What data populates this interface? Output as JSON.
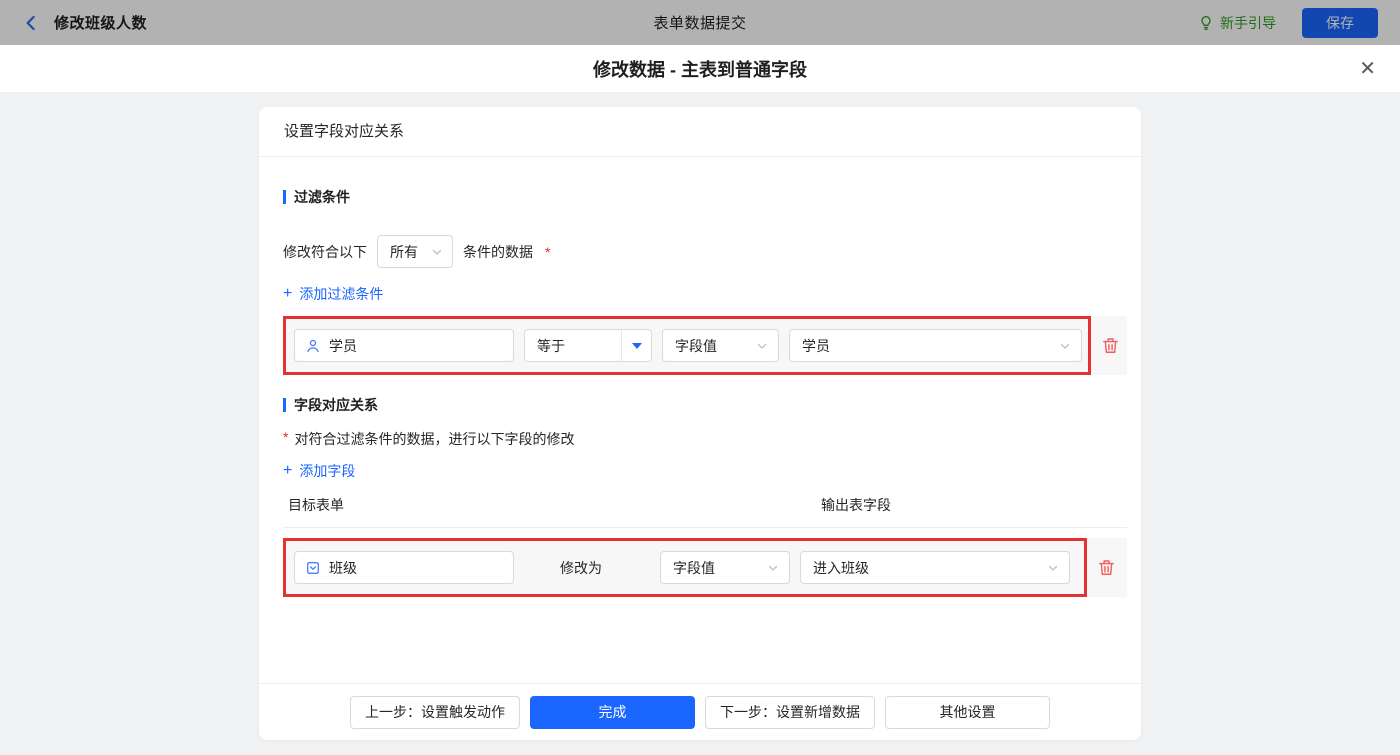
{
  "topbar": {
    "back_title": "修改班级人数",
    "center_title": "表单数据提交",
    "guide_label": "新手引导",
    "save_label": "保存"
  },
  "dialog": {
    "title": "修改数据 - 主表到普通字段",
    "close_glyph": "✕"
  },
  "card": {
    "header_title": "设置字段对应关系",
    "filter": {
      "title": "过滤条件",
      "match_prefix": "修改符合以下",
      "match_value": "所有",
      "match_suffix": "条件的数据",
      "required_mark": "*",
      "plus_glyph": "+",
      "add_label": "添加过滤条件",
      "row": {
        "field": "学员",
        "operator": "等于",
        "value_type": "字段值",
        "value": "学员"
      }
    },
    "mapping": {
      "title": "字段对应关系",
      "required_mark": "*",
      "description": "对符合过滤条件的数据，进行以下字段的修改",
      "plus_glyph": "+",
      "add_label": "添加字段",
      "columns": {
        "target": "目标表单",
        "output": "输出表字段"
      },
      "row": {
        "target_field": "班级",
        "action_label": "修改为",
        "value_type": "字段值",
        "value": "进入班级"
      }
    }
  },
  "footer": {
    "prev_label": "上一步：设置触发动作",
    "done_label": "完成",
    "next_label": "下一步：设置新增数据",
    "other_label": "其他设置"
  },
  "colors": {
    "primary_blue": "#1a66ff",
    "highlight_red": "#e43131",
    "danger_red": "#f25c5c",
    "guide_green": "#2ea121",
    "topbar_dim_overlay": "rgba(0,0,0,0.30)"
  }
}
